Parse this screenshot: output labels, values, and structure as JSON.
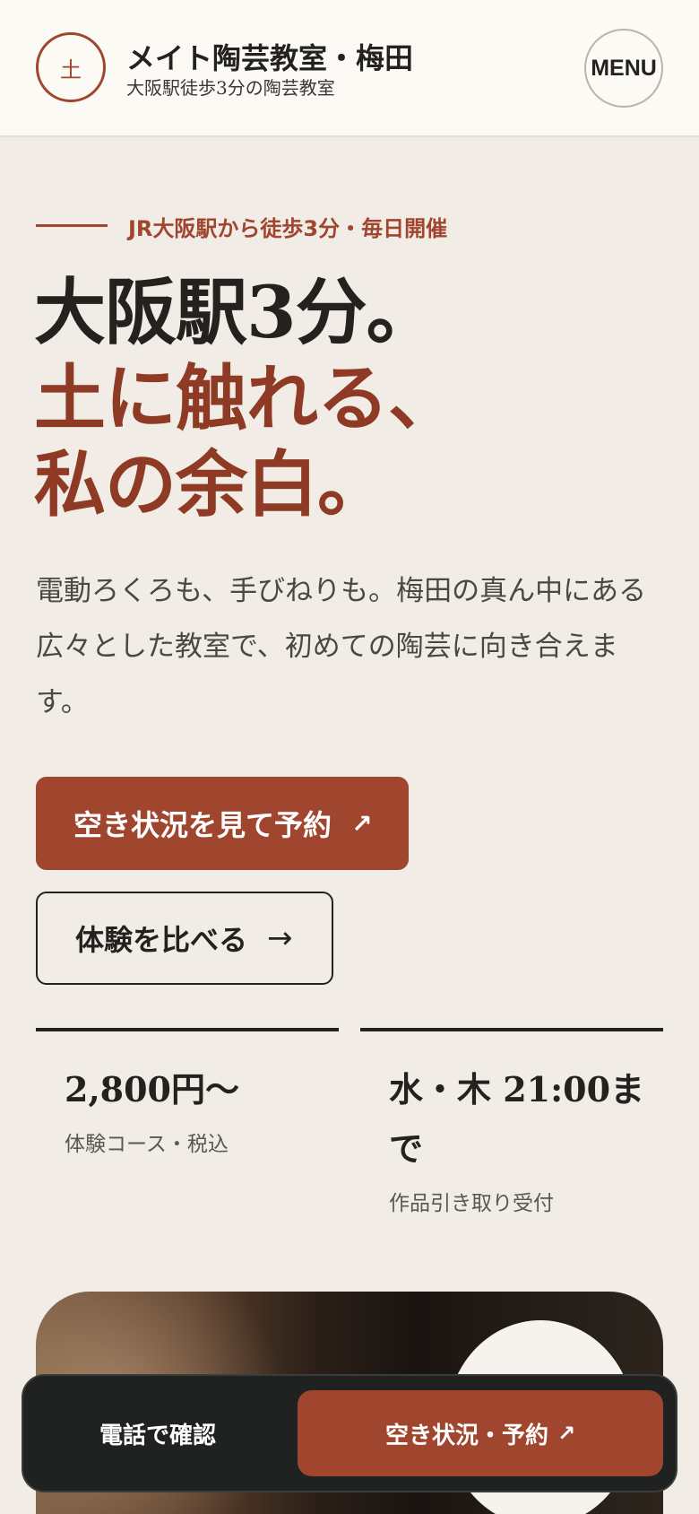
{
  "header": {
    "logo_char": "土",
    "title": "メイト陶芸教室・梅田",
    "subtitle": "大阪駅徒歩3分の陶芸教室",
    "menu_label": "MENU"
  },
  "hero": {
    "eyebrow": "JR大阪駅から徒歩3分・毎日開催",
    "headline_line1": "大阪駅3分。",
    "headline_line2": "土に触れる、",
    "headline_line3": "私の余白。",
    "lead": "電動ろくろも、手びねりも。梅田の真ん中にある広々とした教室で、初めての陶芸に向き合えます。",
    "primary_cta": "空き状況を見て予約",
    "primary_cta_icon": "↗",
    "secondary_cta": "体験を比べる",
    "secondary_cta_icon": "→"
  },
  "stats": [
    {
      "value": "2,800円〜",
      "label": "体験コース・税込"
    },
    {
      "value": "水・木 21:00まで",
      "label": "作品引き取り受付"
    }
  ],
  "bottom_bar": {
    "phone_label": "電話で確認",
    "reserve_label": "空き状況・予約",
    "reserve_icon": "↗"
  },
  "colors": {
    "accent": "#a0452e",
    "headline_accent": "#8f3a25",
    "background": "#f1ede6",
    "header_bg": "#fcfaf4",
    "dark": "#23221f"
  }
}
